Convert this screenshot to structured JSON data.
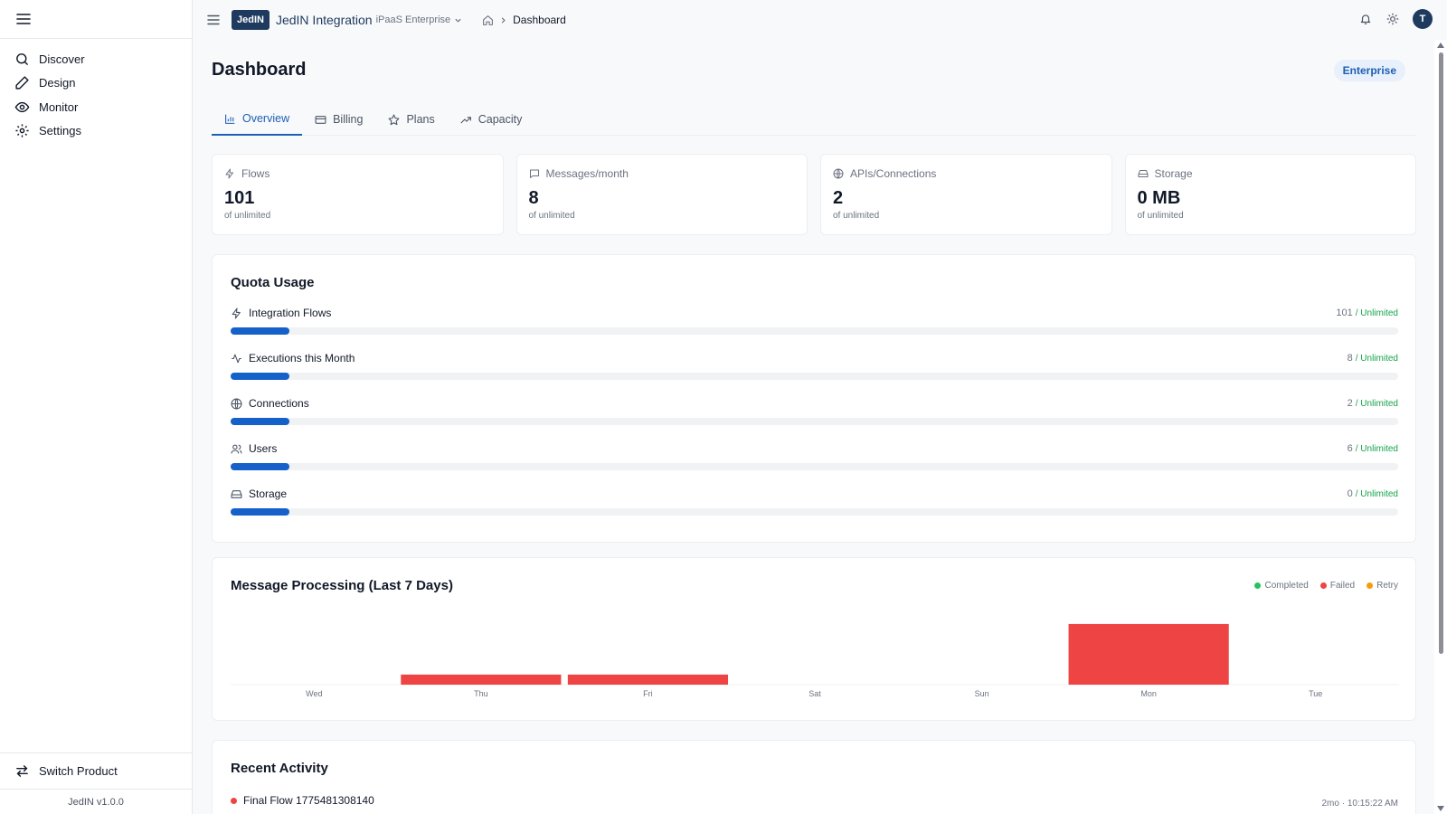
{
  "sidebar": {
    "items": [
      {
        "label": "Discover",
        "icon": "search-icon"
      },
      {
        "label": "Design",
        "icon": "pencil-icon"
      },
      {
        "label": "Monitor",
        "icon": "eye-icon"
      },
      {
        "label": "Settings",
        "icon": "gear-icon"
      }
    ],
    "switch_label": "Switch Product",
    "version": "JedIN v1.0.0"
  },
  "topbar": {
    "logo": "JedIN",
    "brand": "JedIN Integration",
    "edition": "iPaaS Enterprise",
    "breadcrumb_current": "Dashboard",
    "avatar_initial": "T"
  },
  "page": {
    "title": "Dashboard",
    "badge": "Enterprise"
  },
  "tabs": [
    {
      "label": "Overview",
      "icon": "bar-chart-icon",
      "active": true
    },
    {
      "label": "Billing",
      "icon": "credit-card-icon",
      "active": false
    },
    {
      "label": "Plans",
      "icon": "star-icon",
      "active": false
    },
    {
      "label": "Capacity",
      "icon": "trending-up-icon",
      "active": false
    }
  ],
  "stats": [
    {
      "label": "Flows",
      "value": "101",
      "sub": "of unlimited",
      "icon": "zap-icon"
    },
    {
      "label": "Messages/month",
      "value": "8",
      "sub": "of unlimited",
      "icon": "message-icon"
    },
    {
      "label": "APIs/Connections",
      "value": "2",
      "sub": "of unlimited",
      "icon": "globe-icon"
    },
    {
      "label": "Storage",
      "value": "0 MB",
      "sub": "of unlimited",
      "icon": "drive-icon"
    }
  ],
  "quota": {
    "title": "Quota Usage",
    "rows": [
      {
        "label": "Integration Flows",
        "value": "101",
        "limit": "/ Unlimited",
        "icon": "zap-icon",
        "fill_fraction": 0.05
      },
      {
        "label": "Executions this Month",
        "value": "8",
        "limit": "/ Unlimited",
        "icon": "activity-icon",
        "fill_fraction": 0.05
      },
      {
        "label": "Connections",
        "value": "2",
        "limit": "/ Unlimited",
        "icon": "globe-icon",
        "fill_fraction": 0.05
      },
      {
        "label": "Users",
        "value": "6",
        "limit": "/ Unlimited",
        "icon": "users-icon",
        "fill_fraction": 0.05
      },
      {
        "label": "Storage",
        "value": "0",
        "limit": "/ Unlimited",
        "icon": "drive-icon",
        "fill_fraction": 0.05
      }
    ]
  },
  "message_chart": {
    "title": "Message Processing (Last 7 Days)",
    "legend": [
      {
        "label": "Completed",
        "color": "#22c55e"
      },
      {
        "label": "Failed",
        "color": "#ef4444"
      },
      {
        "label": "Retry",
        "color": "#f59e0b"
      }
    ]
  },
  "chart_data": {
    "type": "bar",
    "categories": [
      "Wed",
      "Thu",
      "Fri",
      "Sat",
      "Sun",
      "Mon",
      "Tue"
    ],
    "series": [
      {
        "name": "Completed",
        "values": [
          0,
          0,
          0,
          0,
          0,
          0,
          0
        ]
      },
      {
        "name": "Failed",
        "values": [
          0,
          1,
          1,
          0,
          0,
          6,
          0
        ]
      },
      {
        "name": "Retry",
        "values": [
          0,
          0,
          0,
          0,
          0,
          0,
          0
        ]
      }
    ],
    "colors": {
      "Completed": "#22c55e",
      "Failed": "#ef4444",
      "Retry": "#f59e0b"
    },
    "grid": false
  },
  "activity": {
    "title": "Recent Activity",
    "items": [
      {
        "label": "Final Flow 1775481308140",
        "time": "2mo · 10:15:22 AM"
      }
    ]
  },
  "colors": {
    "accent": "#1560c9",
    "brand": "#1e3a5f",
    "unlimited": "#16a34a"
  }
}
